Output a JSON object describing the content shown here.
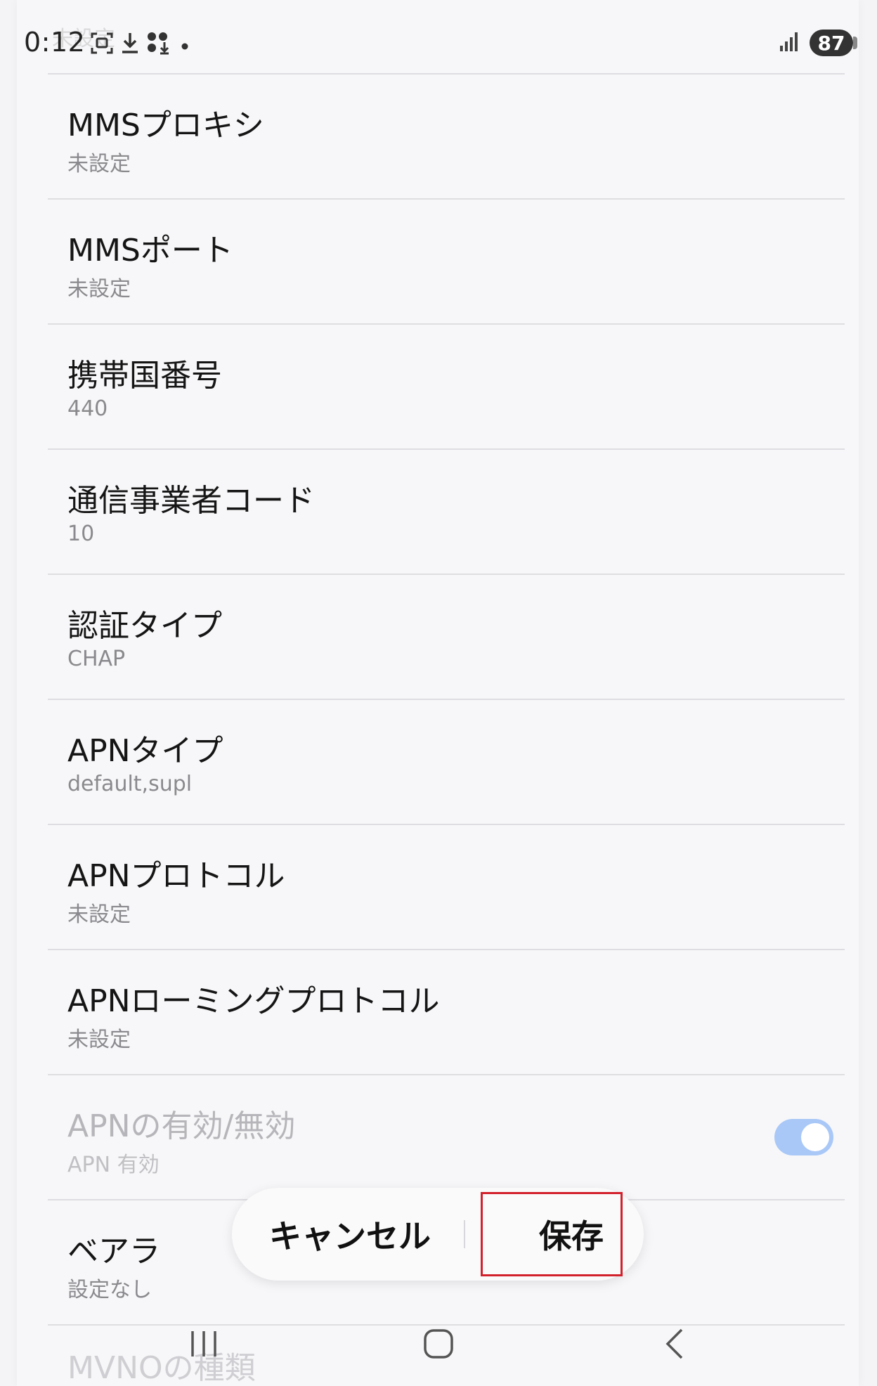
{
  "status_bar": {
    "time": "0:12",
    "battery": "87",
    "icons": [
      "screenshot-icon",
      "download-icon",
      "app-download-icon",
      "dot-icon",
      "signal-icon",
      "battery-icon"
    ]
  },
  "ghost_text": "未設定",
  "settings": {
    "items": [
      {
        "title": "MMSプロキシ",
        "value": "未設定"
      },
      {
        "title": "MMSポート",
        "value": "未設定"
      },
      {
        "title": "携帯国番号",
        "value": "440"
      },
      {
        "title": "通信事業者コード",
        "value": "10"
      },
      {
        "title": "認証タイプ",
        "value": "CHAP"
      },
      {
        "title": "APNタイプ",
        "value": "default,supl"
      },
      {
        "title": "APNプロトコル",
        "value": "未設定"
      },
      {
        "title": "APNローミングプロトコル",
        "value": "未設定"
      },
      {
        "title": "APNの有効/無効",
        "value": "APN 有効",
        "toggle_on": true
      },
      {
        "title": "ベアラ",
        "value": "設定なし"
      },
      {
        "title": "MVNOの種類",
        "value": ""
      }
    ]
  },
  "actions": {
    "cancel_label": "キャンセル",
    "save_label": "保存"
  },
  "colors": {
    "toggle_track": "#a9c8f7",
    "highlight": "#d3212c"
  },
  "nav": {
    "icons": [
      "recent-apps-icon",
      "home-icon",
      "back-icon"
    ]
  }
}
